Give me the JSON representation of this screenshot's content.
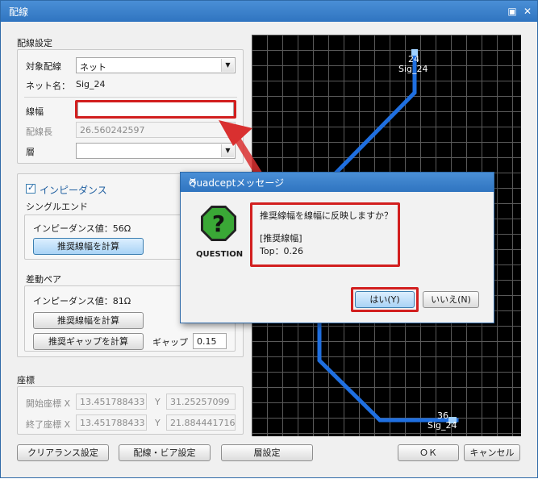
{
  "window": {
    "title": "配線",
    "restore_glyph": "▣",
    "close_glyph": "✕"
  },
  "wiring_settings": {
    "section_label": "配線設定",
    "target_label": "対象配線",
    "target_value": "ネット",
    "netname_label": "ネット名：",
    "netname_value": "Sig_24",
    "width_label": "線幅",
    "width_value": "",
    "length_label": "配線長",
    "length_value": "26.560242597",
    "layer_label": "層",
    "layer_value": ""
  },
  "impedance": {
    "checkbox_label": "インピーダンス",
    "checked": true,
    "single_section": "シングルエンド",
    "single_value_label": "インピーダンス値：56Ω",
    "single_calc_button": "推奨線幅を計算",
    "diff_section": "差動ペア",
    "diff_value_label": "インピーダンス値：81Ω",
    "diff_calc_width_button": "推奨線幅を計算",
    "diff_calc_gap_button": "推奨ギャップを計算",
    "gap_label": "ギャップ",
    "gap_value": "0.15"
  },
  "coordinates": {
    "section_label": "座標",
    "start_label": "開始座標 X",
    "start_x": "13.451788433",
    "start_y_label": "Y",
    "start_y": "31.25257099",
    "end_label": "終了座標 X",
    "end_x": "13.451788433",
    "end_y_label": "Y",
    "end_y": "21.884441716"
  },
  "footer": {
    "clearance_button": "クリアランス設定",
    "via_button": "配線・ビア設定",
    "layer_button": "層設定",
    "ok_button": "ＯＫ",
    "cancel_button": "キャンセル"
  },
  "preview": {
    "top_pin": "24",
    "top_net": "Sig_24",
    "bottom_pin": "36",
    "bottom_net": "Sig_24",
    "trace_color": "#1f6fe0",
    "grid_color": "#5a5a5a"
  },
  "dialog": {
    "title": "Quadceptメッセージ",
    "close_glyph": "✕",
    "icon": "question-icon",
    "icon_caption": "QUESTION",
    "message_line1": "推奨線幅を線幅に反映しますか？",
    "message_line2": "[推奨線幅]",
    "message_line3": "Top：0.26",
    "yes_button": "はい(Y)",
    "no_button": "いいえ(N)"
  },
  "colors": {
    "title_bar": "#3a82cf",
    "highlight_red": "#d21f1f",
    "arrow_red": "#d93030"
  }
}
